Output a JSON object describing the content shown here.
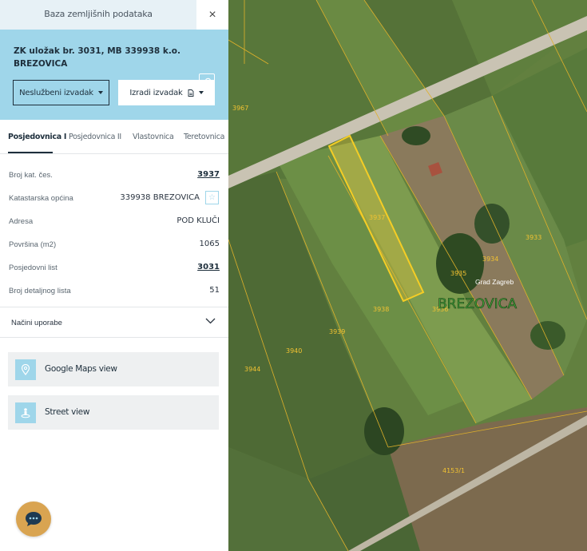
{
  "panel": {
    "topbar_title": "Baza zemljišnih podataka",
    "close": "×",
    "header_title": "ZK uložak br. 3031, MB 339938 k.o. BREZOVICA",
    "btn_unofficial": "Neslužbeni izvadak",
    "btn_make": "Izradi izvadak"
  },
  "tabs": [
    "Posjedovnica I",
    "Posjedovnica II",
    "Vlastovnica",
    "Teretovnica"
  ],
  "details": [
    {
      "label": "Broj kat. čes.",
      "value": "3937"
    },
    {
      "label": "Katastarska općina",
      "value": "339938 BREZOVICA"
    },
    {
      "label": "Adresa",
      "value": "POD KLUČI"
    },
    {
      "label": "Površina (m2)",
      "value": "1065"
    },
    {
      "label": "Posjedovni list",
      "value": "3031"
    },
    {
      "label": "Broj detaljnog lista",
      "value": "51"
    }
  ],
  "accordion_label": "Načini uporabe",
  "cards": {
    "google_maps": "Google Maps view",
    "street_view": "Street view"
  },
  "map": {
    "place": "BREZOVICA",
    "city": "Grad Zagreb",
    "parcels": [
      "3967",
      "3937",
      "3933",
      "3934",
      "3935",
      "3936",
      "3938",
      "3939",
      "3940",
      "3944",
      "4153/1"
    ]
  },
  "colors": {
    "accent": "#9fd6ea",
    "dark": "#1e2f3c",
    "parcel_line": "#f1c232",
    "chat": "#d9a451"
  }
}
